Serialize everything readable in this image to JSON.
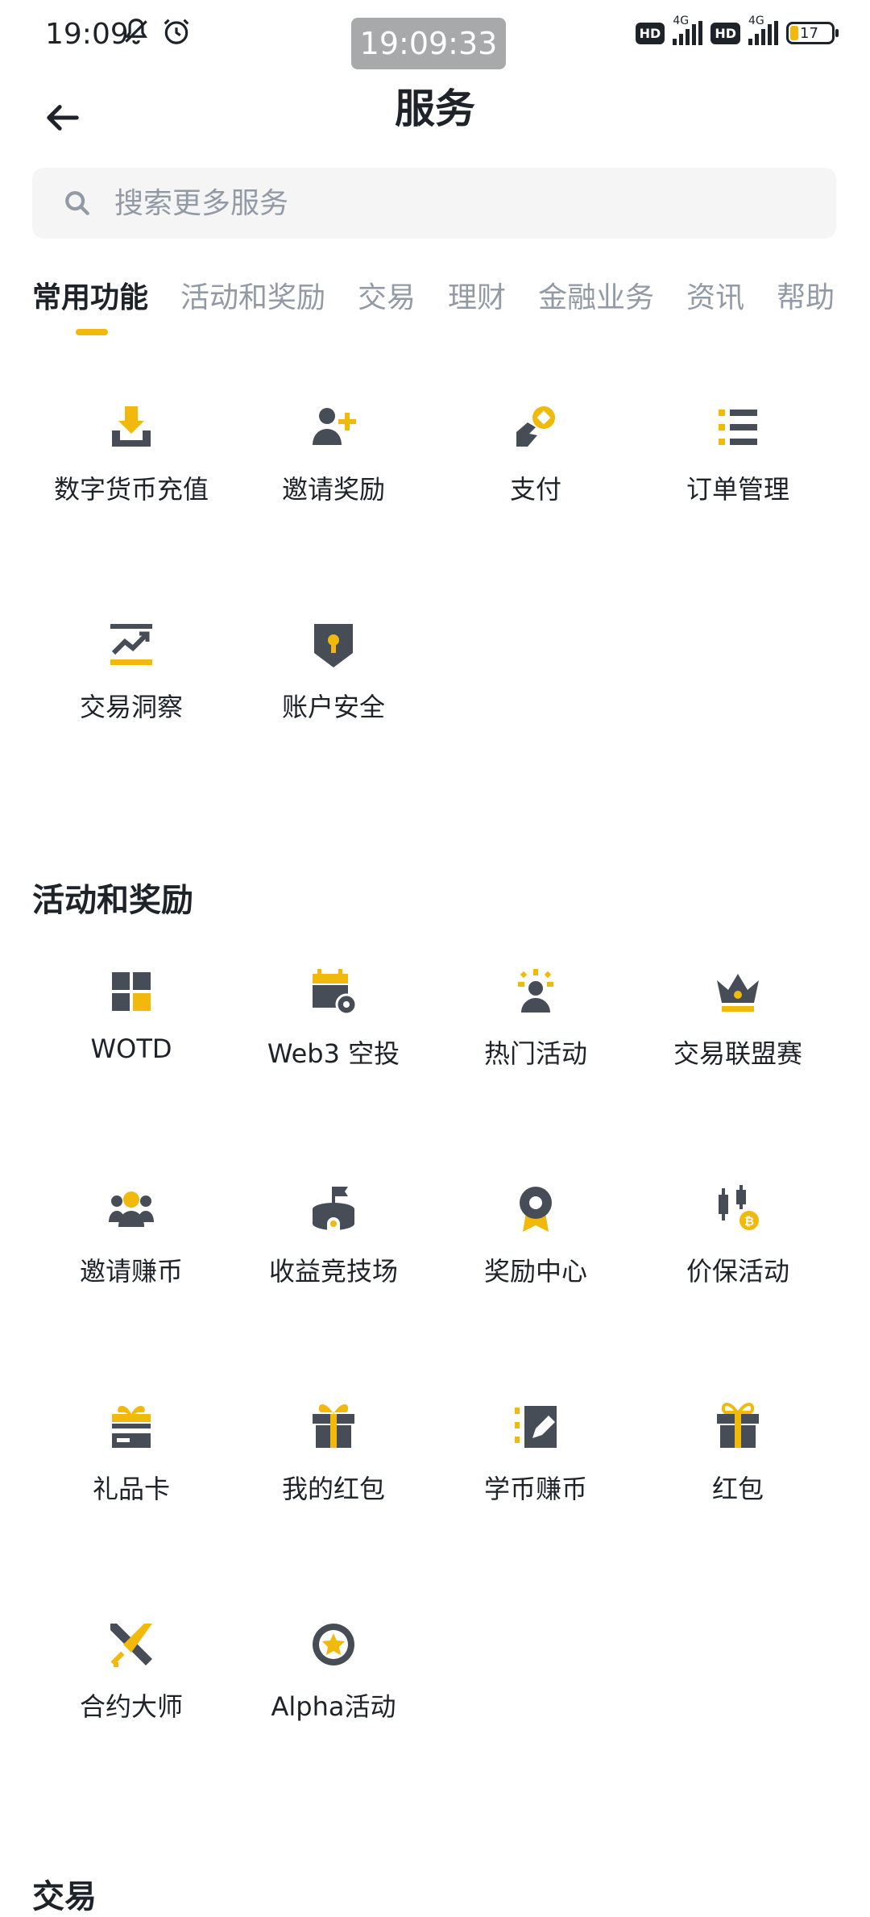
{
  "status_bar": {
    "time": "19:09",
    "center_clock": "19:09:33",
    "network_1": "4G",
    "network_2": "4G",
    "battery": "17",
    "hd_1": "HD",
    "hd_2": "HD"
  },
  "header": {
    "title": "服务"
  },
  "search": {
    "placeholder": "搜索更多服务"
  },
  "tabs": [
    {
      "label": "常用功能"
    },
    {
      "label": "活动和奖励"
    },
    {
      "label": "交易"
    },
    {
      "label": "理财"
    },
    {
      "label": "金融业务"
    },
    {
      "label": "资讯"
    },
    {
      "label": "帮助"
    }
  ],
  "common": {
    "items": [
      {
        "label": "数字货币充值",
        "icon": "deposit-icon"
      },
      {
        "label": "邀请奖励",
        "icon": "add-user-icon"
      },
      {
        "label": "支付",
        "icon": "pay-icon"
      },
      {
        "label": "订单管理",
        "icon": "order-list-icon"
      },
      {
        "label": "交易洞察",
        "icon": "trade-insight-icon"
      },
      {
        "label": "账户安全",
        "icon": "shield-icon"
      }
    ]
  },
  "rewards": {
    "title": "活动和奖励",
    "items": [
      {
        "label": "WOTD",
        "icon": "wotd-icon"
      },
      {
        "label": "Web3 空投",
        "icon": "airdrop-calendar-icon"
      },
      {
        "label": "热门活动",
        "icon": "hot-activity-icon"
      },
      {
        "label": "交易联盟赛",
        "icon": "crown-icon"
      },
      {
        "label": "邀请赚币",
        "icon": "invite-earn-icon"
      },
      {
        "label": "收益竞技场",
        "icon": "arena-icon"
      },
      {
        "label": "奖励中心",
        "icon": "reward-badge-icon"
      },
      {
        "label": "价保活动",
        "icon": "price-protect-icon"
      },
      {
        "label": "礼品卡",
        "icon": "gift-card-icon"
      },
      {
        "label": "我的红包",
        "icon": "gift-box-icon"
      },
      {
        "label": "学币赚币",
        "icon": "learn-earn-icon"
      },
      {
        "label": "红包",
        "icon": "red-packet-icon"
      },
      {
        "label": "合约大师",
        "icon": "swords-icon"
      },
      {
        "label": "Alpha活动",
        "icon": "alpha-star-icon"
      }
    ]
  },
  "next_section": {
    "title": "交易"
  },
  "colors": {
    "accent": "#F0B90B",
    "icon_dark": "#474D57",
    "text_primary": "#1E2329",
    "text_secondary": "#929AA5"
  }
}
